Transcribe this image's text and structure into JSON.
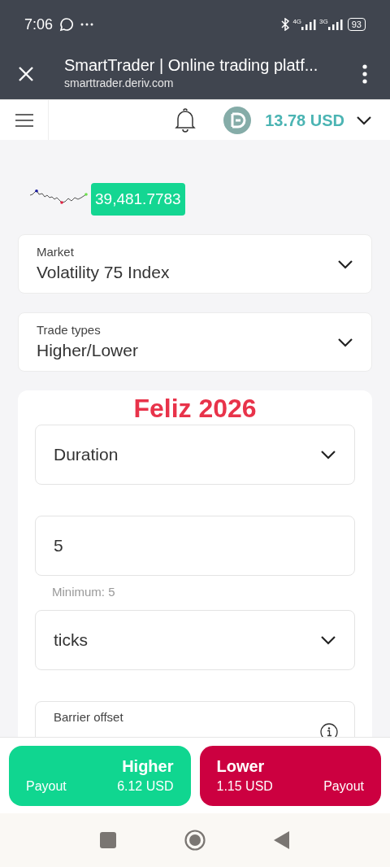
{
  "status_bar": {
    "time": "7:06",
    "network_1": "4G",
    "network_2": "3G",
    "battery": "93"
  },
  "browser": {
    "title": "SmartTrader | Online trading platf...",
    "url": "smarttrader.deriv.com"
  },
  "header": {
    "balance": "13.78 USD"
  },
  "price": "39,481.7783",
  "selects": [
    {
      "label": "Market",
      "value": "Volatility 75 Index"
    },
    {
      "label": "Trade types",
      "value": "Higher/Lower"
    }
  ],
  "overlay_text": "Feliz 2026",
  "form": [
    {
      "kind": "select",
      "value": "Duration"
    },
    {
      "kind": "input",
      "value": "5",
      "hint": "Minimum: 5"
    },
    {
      "kind": "select",
      "value": "ticks"
    },
    {
      "kind": "barrier",
      "label": "Barrier offset"
    }
  ],
  "buttons": [
    {
      "kind": "higher",
      "title": "Higher",
      "payout_label": "Payout",
      "payout": "6.12 USD"
    },
    {
      "kind": "lower",
      "title": "Lower",
      "payout_label": "Payout",
      "payout": "1.15 USD"
    }
  ]
}
